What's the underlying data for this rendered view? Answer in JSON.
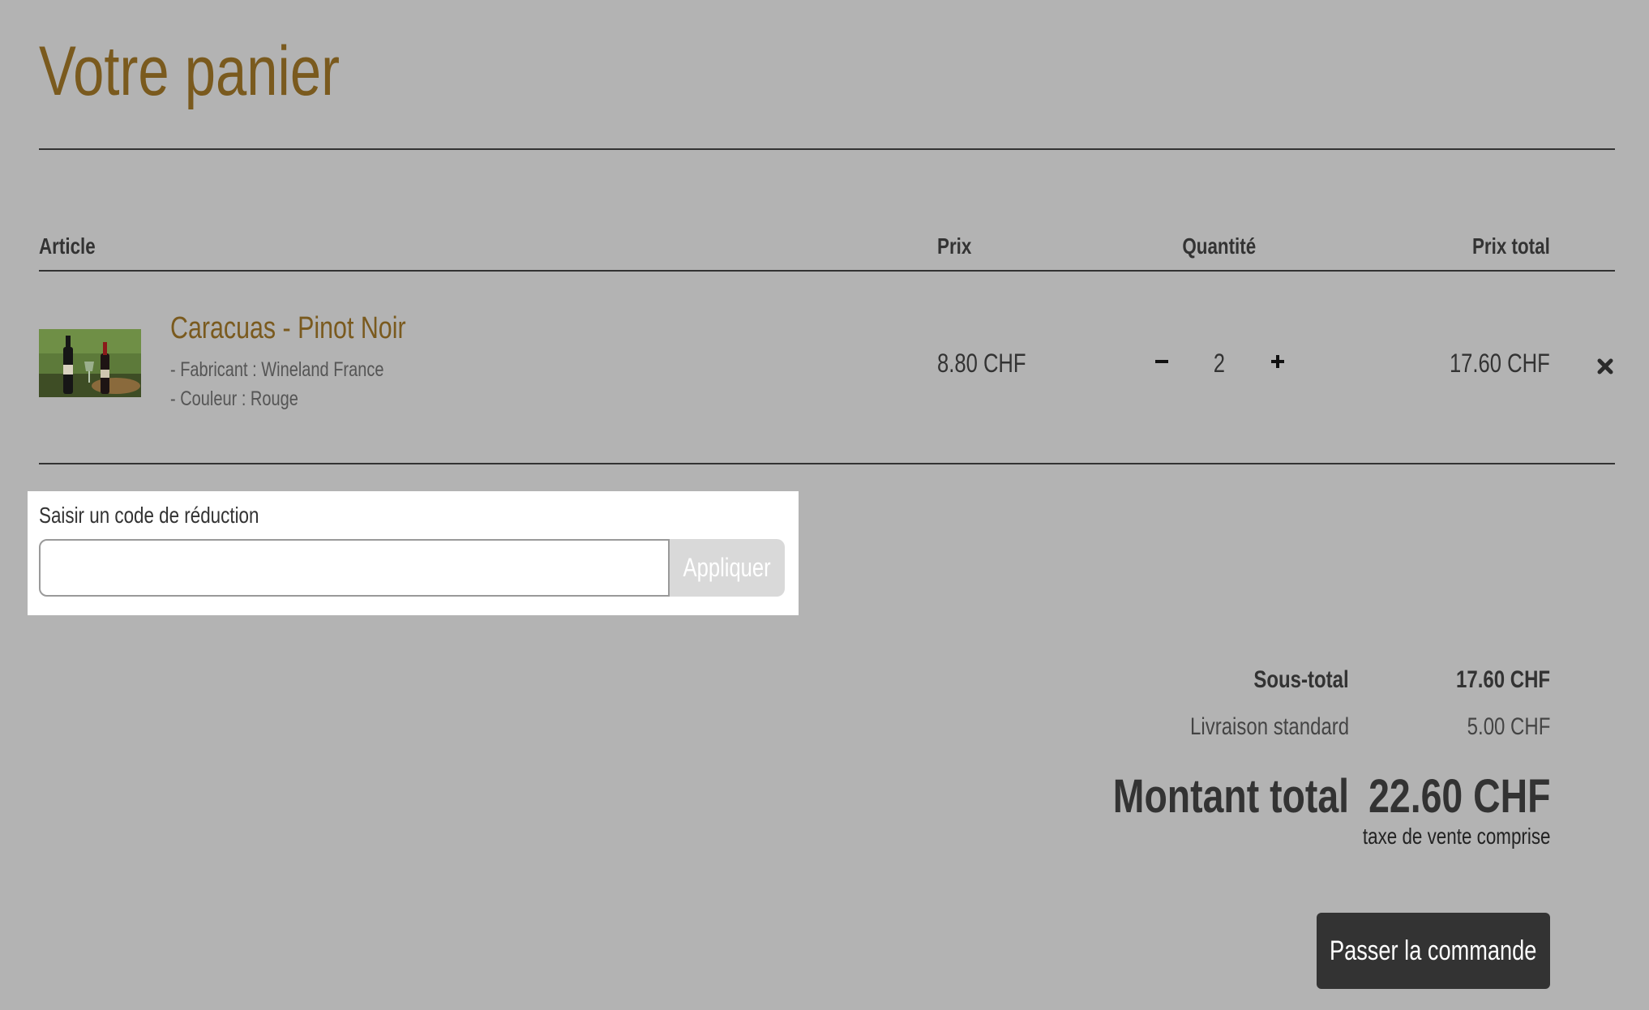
{
  "colors": {
    "background": "#b3b3b3",
    "accent": "#7a5a1e",
    "text": "#333333",
    "coupon_panel": "#ffffff",
    "apply_button": "#d9d9d9",
    "checkout_button": "#333333"
  },
  "page": {
    "title": "Votre panier"
  },
  "table": {
    "headers": {
      "article": "Article",
      "price": "Prix",
      "quantity": "Quantité",
      "total": "Prix total"
    }
  },
  "cart": {
    "items": [
      {
        "image_icon": "wine-bottles-photo",
        "name": "Caracuas - Pinot Noir",
        "manufacturer": "- Fabricant : Wineland France",
        "color": "- Couleur : Rouge",
        "price": "8.80 CHF",
        "quantity": "2",
        "total": "17.60 CHF"
      }
    ]
  },
  "coupon": {
    "label": "Saisir un code de réduction",
    "value": "",
    "placeholder": "",
    "apply_label": "Appliquer"
  },
  "summary": {
    "subtotal_label": "Sous-total",
    "subtotal_value": "17.60 CHF",
    "shipping_label": "Livraison standard",
    "shipping_value": "5.00 CHF",
    "total_label": "Montant total",
    "total_value": "22.60 CHF",
    "tax_note": "taxe de vente comprise"
  },
  "checkout": {
    "label": "Passer la commande"
  }
}
